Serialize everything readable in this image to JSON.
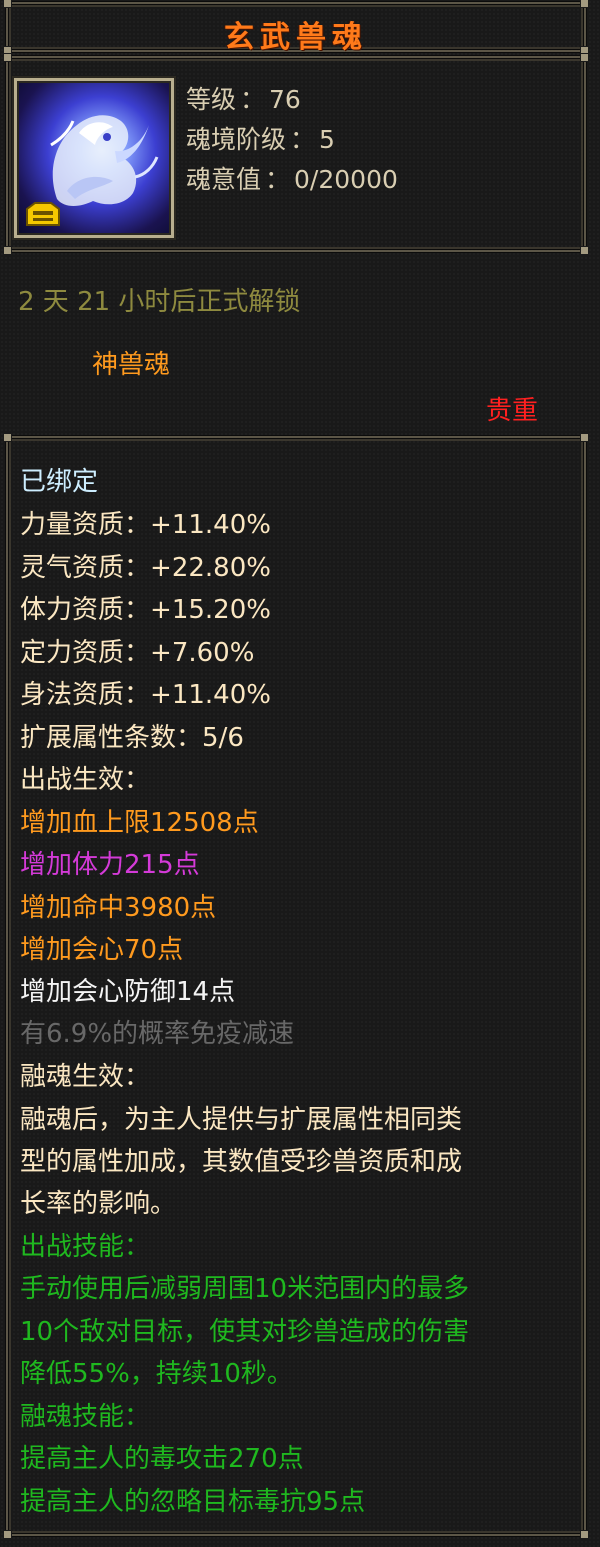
{
  "title": "玄武兽魂",
  "icon": {
    "name": "xuanwu-beast-soul-icon",
    "badge": "lock-badge-icon"
  },
  "info": {
    "level_label": "等级",
    "level_value": "76",
    "realm_label": "魂境阶级",
    "realm_value": "5",
    "soul_label": "魂意值",
    "soul_value": "0/20000"
  },
  "unlock_text": "2 天 21 小时后正式解锁",
  "category": "神兽魂",
  "rarity": "贵重",
  "bound": "已绑定",
  "attributes": [
    {
      "label": "力量资质",
      "value": "+11.40%"
    },
    {
      "label": "灵气资质",
      "value": "+22.80%"
    },
    {
      "label": "体力资质",
      "value": "+15.20%"
    },
    {
      "label": "定力资质",
      "value": "+7.60%"
    },
    {
      "label": "身法资质",
      "value": "+11.40%"
    },
    {
      "label": "扩展属性条数",
      "value": "5/6"
    }
  ],
  "battle_effect_header": "出战生效：",
  "battle_effects": [
    "增加血上限12508点",
    "增加体力215点",
    "增加命中3980点",
    "增加会心70点",
    "增加会心防御14点",
    "有6.9%的概率免疫减速"
  ],
  "fusion_effect_header": "融魂生效：",
  "fusion_desc": [
    "融魂后，为主人提供与扩展属性相同类",
    "型的属性加成，其数值受珍兽资质和成",
    "长率的影响。"
  ],
  "battle_skill_header": "出战技能：",
  "battle_skill": [
    "手动使用后减弱周围10米范围内的最多",
    "10个敌对目标，使其对珍兽造成的伤害",
    "降低55%，持续10秒。"
  ],
  "fusion_skill_header": "融魂技能：",
  "fusion_skills": [
    "提高主人的毒攻击270点",
    "提高主人的忽略目标毒抗95点"
  ],
  "colors": {
    "title": "#ff7a1a",
    "olive": "#8e8a3f",
    "orange": "#ff9a1e",
    "red": "#ff2020",
    "cyan": "#cdeeff",
    "cream": "#fbe7c2",
    "purple": "#d43ad8",
    "white": "#f4f4f4",
    "gray": "#686868",
    "green": "#1fb81f"
  }
}
